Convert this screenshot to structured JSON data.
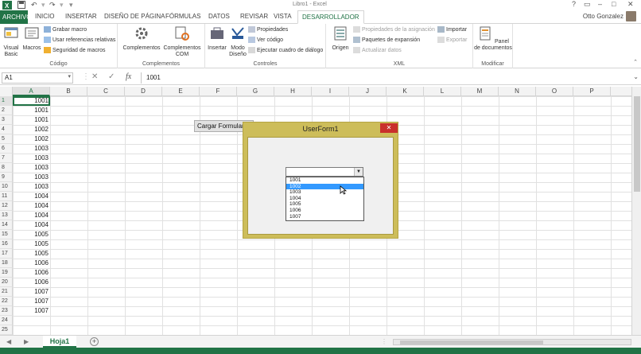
{
  "app": {
    "title": "Libro1 - Excel"
  },
  "quick_access": {
    "icons": [
      "excel-logo-icon",
      "save-icon",
      "undo-icon",
      "redo-icon",
      "customize-icon"
    ]
  },
  "tabs": [
    {
      "label": "ARCHIVO"
    },
    {
      "label": "INICIO"
    },
    {
      "label": "INSERTAR"
    },
    {
      "label": "DISEÑO DE PÁGINA"
    },
    {
      "label": "FÓRMULAS"
    },
    {
      "label": "DATOS"
    },
    {
      "label": "REVISAR"
    },
    {
      "label": "VISTA"
    },
    {
      "label": "DESARROLLADOR"
    }
  ],
  "user": {
    "name": "Otto Gonzalez"
  },
  "ribbon": {
    "codigo": {
      "label": "Código",
      "visual_basic": "Visual Basic",
      "macros": "Macros",
      "grabar": "Grabar macro",
      "referencias": "Usar referencias relativas",
      "seguridad": "Seguridad de macros"
    },
    "complementos": {
      "label": "Complementos",
      "complementos": "Complementos",
      "com": "Complementos COM"
    },
    "controles": {
      "label": "Controles",
      "insertar": "Insertar",
      "modo": "Modo Diseño",
      "propiedades": "Propiedades",
      "ver_codigo": "Ver código",
      "ejecutar": "Ejecutar cuadro de diálogo"
    },
    "xml": {
      "label": "XML",
      "origen": "Origen",
      "prop_asignacion": "Propiedades de la asignación",
      "paquetes": "Paquetes de expansión",
      "actualizar": "Actualizar datos",
      "importar": "Importar",
      "exportar": "Exportar"
    },
    "modificar": {
      "label": "Modificar",
      "panel": "Panel de documentos"
    }
  },
  "formula_bar": {
    "name_box": "A1",
    "fx": "fx",
    "value": "1001"
  },
  "grid": {
    "columns": [
      "A",
      "B",
      "C",
      "D",
      "E",
      "F",
      "G",
      "H",
      "I",
      "J",
      "K",
      "L",
      "M",
      "N",
      "O",
      "P"
    ],
    "rows": [
      "1",
      "2",
      "3",
      "4",
      "5",
      "6",
      "7",
      "8",
      "9",
      "10",
      "11",
      "12",
      "13",
      "14",
      "15",
      "16",
      "17",
      "18",
      "19",
      "20",
      "21",
      "22",
      "23",
      "24",
      "25"
    ],
    "col_a": [
      "1001",
      "1001",
      "1001",
      "1002",
      "1002",
      "1003",
      "1003",
      "1003",
      "1003",
      "1003",
      "1004",
      "1004",
      "1004",
      "1004",
      "1005",
      "1005",
      "1005",
      "1006",
      "1006",
      "1006",
      "1007",
      "1007",
      "1007"
    ]
  },
  "cargar_button": {
    "label": "Cargar Formulario"
  },
  "userform": {
    "title": "UserForm1",
    "close": "✕",
    "combo_value": "",
    "options": [
      "1001",
      "1002",
      "1003",
      "1004",
      "1005",
      "1006",
      "1007"
    ],
    "highlighted_index": 1
  },
  "sheets": [
    {
      "label": "Hoja1"
    }
  ],
  "colors": {
    "accent": "#217346",
    "form_frame": "#cdbd5a",
    "highlight": "#3399ff",
    "close": "#c9302c"
  }
}
